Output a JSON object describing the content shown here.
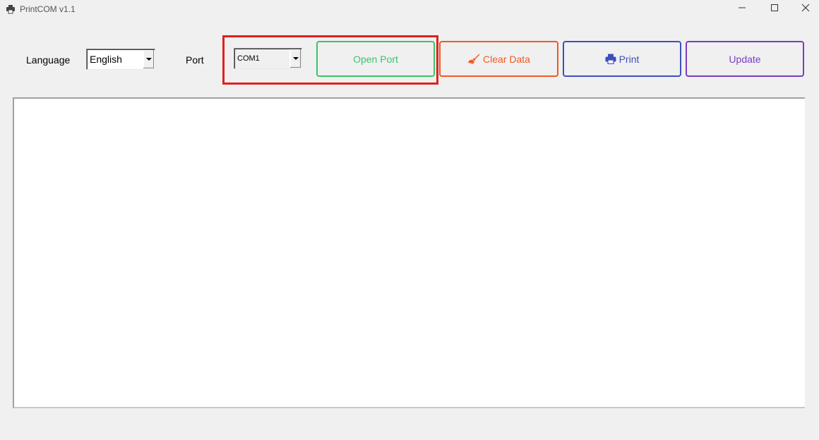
{
  "window": {
    "title": "PrintCOM v1.1",
    "icon": "printer-icon",
    "controls": [
      "minimize-icon",
      "maximize-icon",
      "close-icon"
    ]
  },
  "toolbar": {
    "language_label": "Language",
    "language_value": "English",
    "port_label": "Port",
    "port_value": "COM1",
    "open_port_label": "Open Port",
    "clear_data_label": "Clear Data",
    "print_label": "Print",
    "update_label": "Update"
  },
  "colors": {
    "open_port": "#3cc36a",
    "clear_data": "#f05a1e",
    "print": "#3d4fbd",
    "update": "#7a3cc4",
    "highlight": "#e02020"
  },
  "output": {
    "text": ""
  }
}
